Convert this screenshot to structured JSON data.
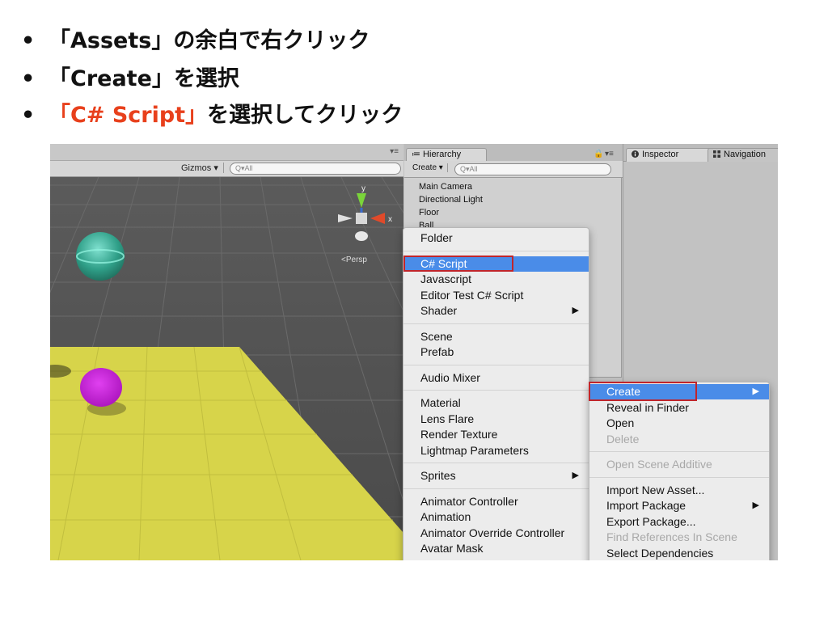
{
  "slide": {
    "bullets": [
      {
        "marker": "•",
        "text": "「Assets」の余白で右クリック"
      },
      {
        "marker": "•",
        "text": "「Create」を選択"
      },
      {
        "marker": "•",
        "highlight": "「C# Script」",
        "rest": "を選択してクリック",
        "highlight_color": "#e8401c"
      }
    ]
  },
  "scene": {
    "gizmos_label": "Gizmos ▾",
    "search_placeholder": "Q▾All",
    "gizmo_axes": {
      "y": "y",
      "x": "x"
    },
    "persp_label": "<Persp",
    "tab_menu": "▾≡"
  },
  "hierarchy": {
    "tab_label": "≔ Hierarchy",
    "create_label": "Create ▾",
    "search_placeholder": "Q▾All",
    "lock_icon": "🔒",
    "tab_menu": "▾≡",
    "items": [
      "Main Camera",
      "Directional Light",
      "Floor",
      "Ball"
    ]
  },
  "inspector": {
    "tab_label": "Inspector",
    "navigation_label": "Navigation"
  },
  "create_menu": {
    "items": [
      {
        "label": "Folder"
      },
      {
        "sep": true
      },
      {
        "label": "C# Script",
        "selected": true
      },
      {
        "label": "Javascript"
      },
      {
        "label": "Editor Test C# Script"
      },
      {
        "label": "Shader",
        "submenu": true
      },
      {
        "sep": true
      },
      {
        "label": "Scene"
      },
      {
        "label": "Prefab"
      },
      {
        "sep": true
      },
      {
        "label": "Audio Mixer"
      },
      {
        "sep": true
      },
      {
        "label": "Material"
      },
      {
        "label": "Lens Flare"
      },
      {
        "label": "Render Texture"
      },
      {
        "label": "Lightmap Parameters"
      },
      {
        "sep": true
      },
      {
        "label": "Sprites",
        "submenu": true
      },
      {
        "sep": true
      },
      {
        "label": "Animator Controller"
      },
      {
        "label": "Animation"
      },
      {
        "label": "Animator Override Controller"
      },
      {
        "label": "Avatar Mask"
      }
    ]
  },
  "context_menu": {
    "items": [
      {
        "label": "Create",
        "selected": true,
        "submenu": true
      },
      {
        "label": "Reveal in Finder"
      },
      {
        "label": "Open"
      },
      {
        "label": "Delete",
        "disabled": true
      },
      {
        "sep": true
      },
      {
        "label": "Open Scene Additive",
        "disabled": true
      },
      {
        "sep": true
      },
      {
        "label": "Import New Asset..."
      },
      {
        "label": "Import Package",
        "submenu": true
      },
      {
        "label": "Export Package..."
      },
      {
        "label": "Find References In Scene",
        "disabled": true
      },
      {
        "label": "Select Dependencies"
      }
    ]
  },
  "colors": {
    "accent_red": "#e8401c",
    "menu_selection": "#4a8ce8",
    "highlight_box": "#c0252b",
    "floor_yellow": "#d7d44a",
    "ball_magenta": "#c41fd6",
    "sphere_teal": "#2f8f7a"
  }
}
